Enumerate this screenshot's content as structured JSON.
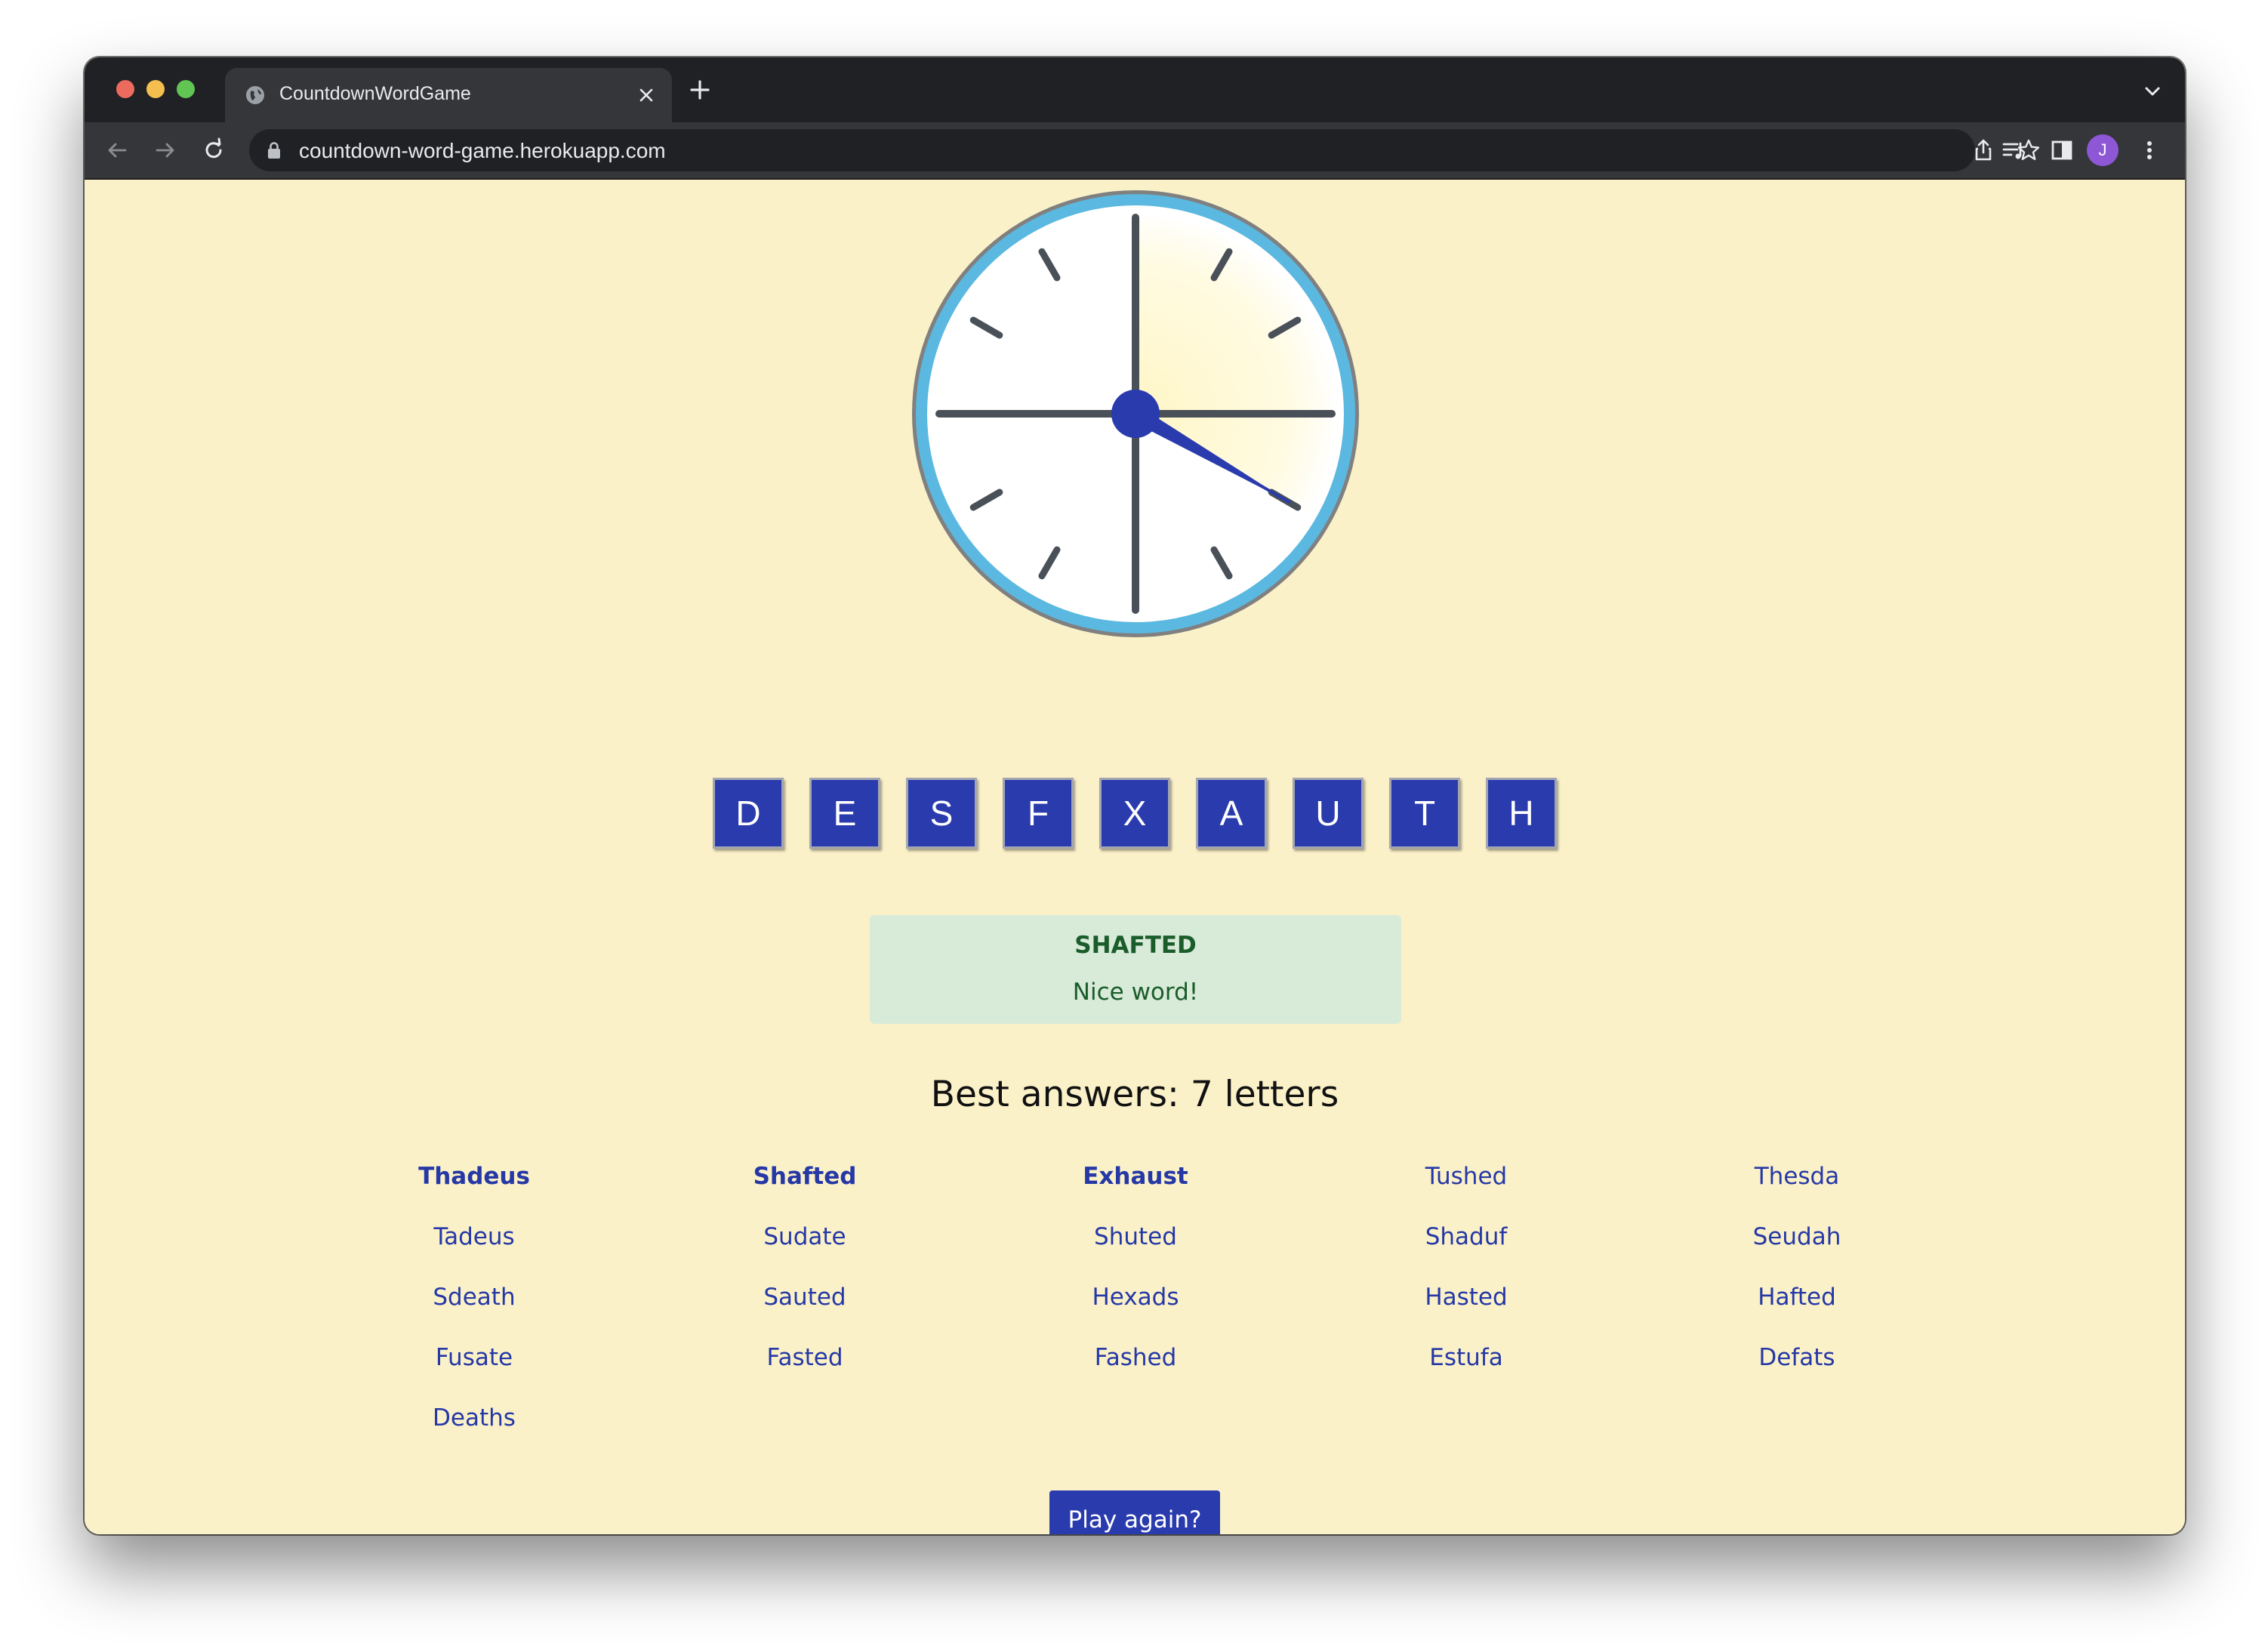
{
  "browser": {
    "tab_title": "CountdownWordGame",
    "url": "countdown-word-game.herokuapp.com",
    "avatar_initial": "J"
  },
  "game": {
    "letters": [
      "D",
      "E",
      "S",
      "F",
      "X",
      "A",
      "U",
      "T",
      "H"
    ],
    "result": {
      "word": "SHAFTED",
      "message": "Nice word!"
    },
    "best_heading": "Best answers: 7 letters",
    "answers": [
      [
        "Thadeus",
        "Tadeus",
        "Sdeath",
        "Fusate",
        "Deaths"
      ],
      [
        "Shafted",
        "Sudate",
        "Sauted",
        "Fasted"
      ],
      [
        "Exhaust",
        "Shuted",
        "Hexads",
        "Fashed"
      ],
      [
        "Tushed",
        "Shaduf",
        "Hasted",
        "Estufa"
      ],
      [
        "Thesda",
        "Seudah",
        "Hafted",
        "Defats"
      ]
    ],
    "bold_answers": [
      "Thadeus",
      "Shafted",
      "Exhaust"
    ],
    "play_again_label": "Play again?",
    "timer_elapsed_fraction": 0.333
  },
  "colors": {
    "page_background": "#fbf1c9",
    "tile": "#2a3cad",
    "answer_link": "#2538a6",
    "alert_background": "#d8ead8",
    "alert_text": "#1a5c2a",
    "clock_ring": "#5bb8e0",
    "clock_hand": "#2a3cad"
  }
}
